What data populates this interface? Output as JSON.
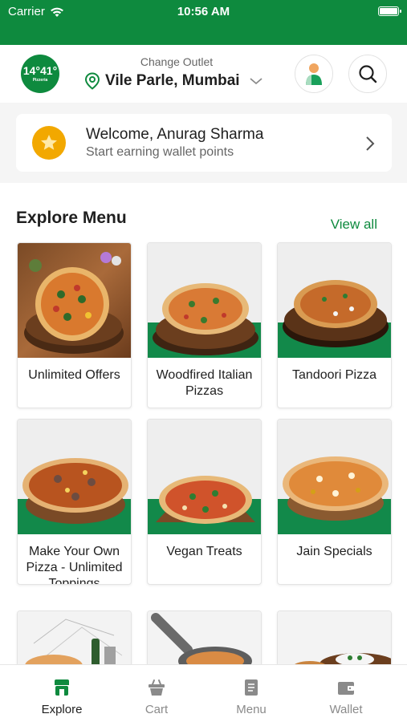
{
  "status_bar": {
    "carrier": "Carrier",
    "time": "10:56 AM",
    "battery_level": 1.0
  },
  "header": {
    "logo_text": "14°41°",
    "logo_subtext": "Pizzeria",
    "outlet_label": "Change Outlet",
    "outlet_name": "Vile Parle, Mumbai",
    "icons": [
      "location-pin-icon",
      "chevron-down-icon",
      "profile-icon",
      "search-icon"
    ]
  },
  "welcome": {
    "title": "Welcome, Anurag Sharma",
    "subtitle": "Start earning wallet points",
    "icon": "star-icon"
  },
  "explore_menu": {
    "title": "Explore Menu",
    "view_all": "View all",
    "items": [
      {
        "label": "Unlimited Offers"
      },
      {
        "label": "Woodfired Italian Pizzas"
      },
      {
        "label": "Tandoori Pizza"
      },
      {
        "label": "Make Your Own Pizza - Unlimited Toppings"
      },
      {
        "label": "Vegan Treats"
      },
      {
        "label": "Jain Specials"
      },
      {
        "label": ""
      },
      {
        "label": ""
      },
      {
        "label": ""
      }
    ]
  },
  "tabbar": {
    "tabs": [
      {
        "label": "Explore",
        "icon": "store-icon",
        "active": true
      },
      {
        "label": "Cart",
        "icon": "cart-icon",
        "active": false
      },
      {
        "label": "Menu",
        "icon": "menu-book-icon",
        "active": false
      },
      {
        "label": "Wallet",
        "icon": "wallet-icon",
        "active": false
      }
    ]
  },
  "colors": {
    "brand_green": "#0e8a3e",
    "star_gold": "#f2a800"
  }
}
